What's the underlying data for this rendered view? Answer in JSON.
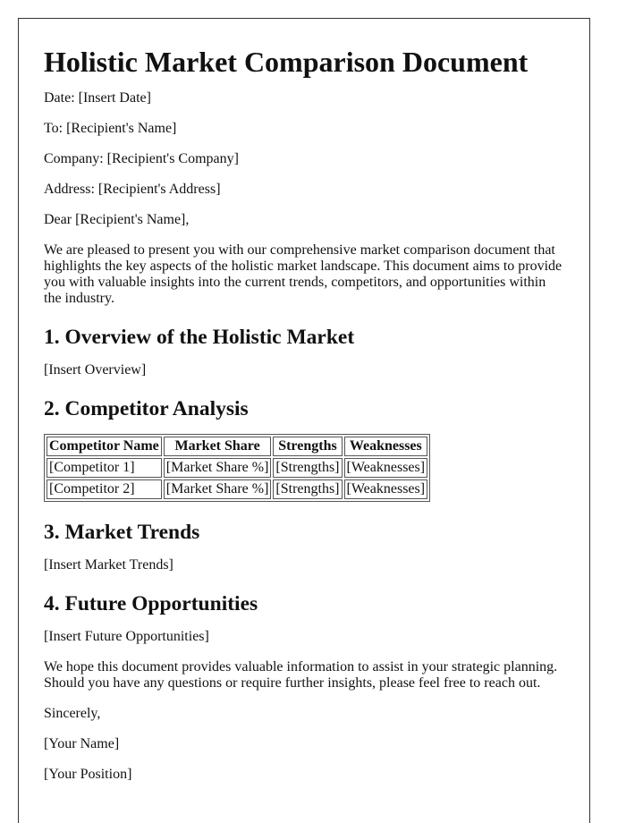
{
  "document": {
    "title": "Holistic Market Comparison Document",
    "header_lines": [
      "Date: [Insert Date]",
      "To: [Recipient's Name]",
      "Company: [Recipient's Company]",
      "Address: [Recipient's Address]"
    ],
    "salutation": "Dear [Recipient's Name],",
    "intro": "We are pleased to present you with our comprehensive market comparison document that highlights the key aspects of the holistic market landscape. This document aims to provide you with valuable insights into the current trends, competitors, and opportunities within the industry.",
    "sections": [
      {
        "heading": "1. Overview of the Holistic Market",
        "body": "[Insert Overview]"
      },
      {
        "heading": "2. Competitor Analysis"
      },
      {
        "heading": "3. Market Trends",
        "body": "[Insert Market Trends]"
      },
      {
        "heading": "4. Future Opportunities",
        "body": "[Insert Future Opportunities]"
      }
    ],
    "table": {
      "headers": [
        "Competitor Name",
        "Market Share",
        "Strengths",
        "Weaknesses"
      ],
      "rows": [
        [
          "[Competitor 1]",
          "[Market Share %]",
          "[Strengths]",
          "[Weaknesses]"
        ],
        [
          "[Competitor 2]",
          "[Market Share %]",
          "[Strengths]",
          "[Weaknesses]"
        ]
      ]
    },
    "closing": "We hope this document provides valuable information to assist in your strategic planning. Should you have any questions or require further insights, please feel free to reach out.",
    "signoff": "Sincerely,",
    "signature": [
      "[Your Name]",
      "[Your Position]"
    ]
  }
}
